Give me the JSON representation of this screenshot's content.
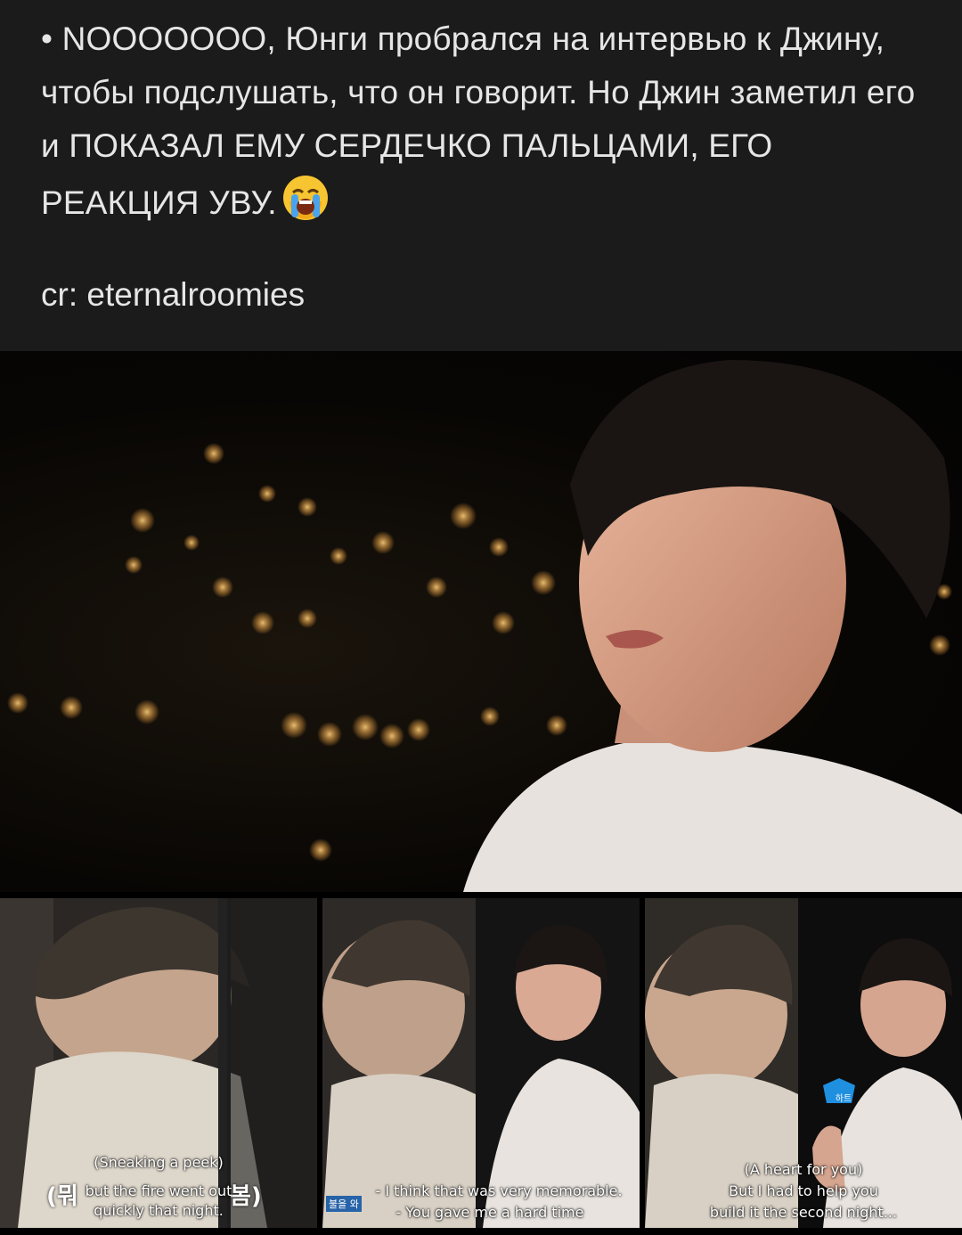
{
  "post": {
    "text": "• NOOOOOOO, Юнги пробрался на интервью к Джину, чтобы подслушать, что он говорит. Но Джин заметил его и ПОКАЗАЛ ЕМУ СЕРДЕЧКО ПАЛЬЦАМИ, ЕГО РЕАКЦИЯ УВУ.",
    "emoji": "loudly-crying-face-icon",
    "credit": "cr: eternalroomies"
  },
  "panels": [
    {
      "caption_top": "(Sneaking a peek)",
      "caption_line1": "but the fire went out",
      "caption_line2": "quickly that night.",
      "overlay_left": "(뭐",
      "overlay_right": "봄)"
    },
    {
      "caption_line1": "- I think that was very memorable.",
      "caption_line2": "- You gave me a hard time",
      "overlay_tag": "불을 와"
    },
    {
      "caption_top": "(A heart for you)",
      "caption_line1": "But I had to help you",
      "caption_line2": "build it the second night...",
      "badge": "하트"
    }
  ],
  "colors": {
    "post_background": "#1c1b1b",
    "post_text": "#e6e6e6",
    "badge": "#1f8fe0"
  }
}
